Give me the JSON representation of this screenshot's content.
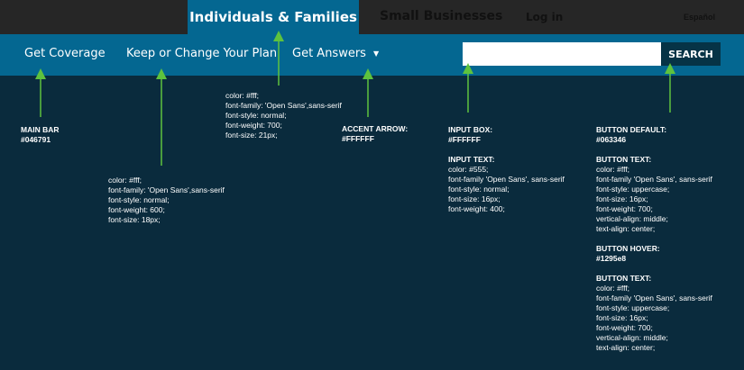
{
  "colors": {
    "top_bar": "#262626",
    "main_bar": "#046791",
    "background": "#0a2b3d",
    "button_default": "#063346",
    "arrow": "#5ec23e"
  },
  "top_nav": {
    "tab_active": "Individuals & Families",
    "tab_small_business": "Small Businesses",
    "login": "Log in",
    "language": "Español"
  },
  "main_nav": {
    "get_coverage": "Get Coverage",
    "keep_change": "Keep or Change Your Plan",
    "get_answers": "Get Answers",
    "get_answers_icon": "caret-down-icon"
  },
  "search": {
    "value": "",
    "button_label": "SEARCH"
  },
  "annotations": {
    "main_bar": [
      "MAIN BAR",
      "#046791"
    ],
    "tab_font": [
      "color: #fff;",
      "font-family: 'Open Sans',sans-serif",
      "font-style: normal;",
      "font-weight: 700;",
      "font-size: 21px;"
    ],
    "accent_arrow": [
      "ACCENT ARROW:",
      "#FFFFFF"
    ],
    "nav_font": [
      "color: #fff;",
      "font-family: 'Open Sans',sans-serif",
      "font-style: normal;",
      "font-weight: 600;",
      "font-size: 18px;"
    ],
    "input_box": [
      "INPUT BOX:",
      "#FFFFFF"
    ],
    "input_text_head": "INPUT TEXT:",
    "input_text": [
      "color: #555;",
      "font-family  'Open Sans', sans-serif",
      "font-style: normal;",
      "font-size: 16px;",
      "font-weight: 400;"
    ],
    "button_default": [
      "BUTTON DEFAULT:",
      "#063346"
    ],
    "button_text_head_1": "BUTTON TEXT:",
    "button_text_1": [
      "color: #fff;",
      "font-family  'Open Sans', sans-serif",
      "font-style: uppercase;",
      "font-size: 16px;",
      "font-weight: 700;",
      "vertical-align: middle;",
      "text-align: center;"
    ],
    "button_hover": [
      "BUTTON HOVER:",
      "#1295e8"
    ],
    "button_text_head_2": "BUTTON TEXT:",
    "button_text_2": [
      "color: #fff;",
      "font-family  'Open Sans', sans-serif",
      "font-style: uppercase;",
      "font-size: 16px;",
      "font-weight: 700;",
      "vertical-align: middle;",
      "text-align: center;"
    ]
  }
}
